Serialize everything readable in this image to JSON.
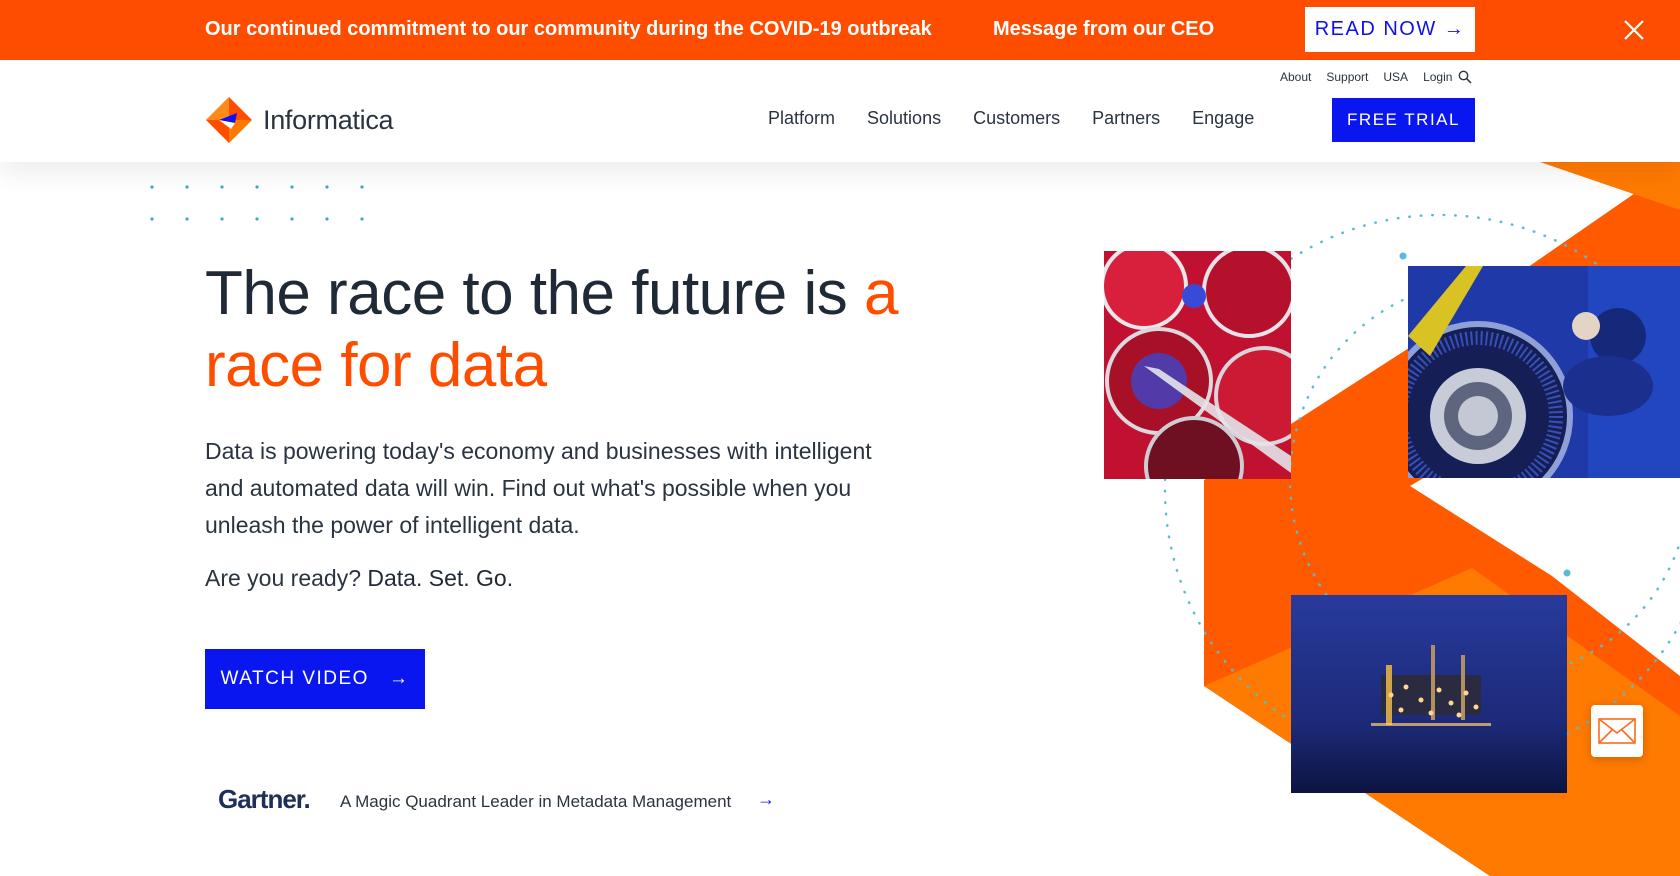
{
  "banner": {
    "text": "Our continued commitment to our community during the COVID-19 outbreak",
    "ceo_message": "Message from our CEO",
    "read_now": "READ NOW →",
    "close_icon": "close-icon"
  },
  "header": {
    "logo_text": "Informatica",
    "utility": {
      "about": "About",
      "support": "Support",
      "region": "USA",
      "login": "Login",
      "search_icon": "search-icon"
    },
    "nav": [
      "Platform",
      "Solutions",
      "Customers",
      "Partners",
      "Engage"
    ],
    "free_trial": "FREE TRIAL"
  },
  "hero": {
    "headline_main": "The race to the future is ",
    "headline_accent": "a race for data",
    "lead": "Data is powering today's economy and businesses with intelligent and automated data will win. Find out what's possible when you unleash the power of intelligent data.",
    "ready_prefix": "Are you ready? ",
    "ready_bold": "Data. Set. Go.",
    "watch_label": "WATCH VIDEO",
    "watch_arrow": "→"
  },
  "gartner": {
    "logo": "Gartner.",
    "text": "A Magic Quadrant Leader in Metadata Management",
    "arrow": "→"
  },
  "colors": {
    "brand_orange": "#ff4d00",
    "cta_blue": "#0a16f0",
    "text_dark": "#1f2a36"
  },
  "floating": {
    "mail_icon": "envelope-icon"
  }
}
